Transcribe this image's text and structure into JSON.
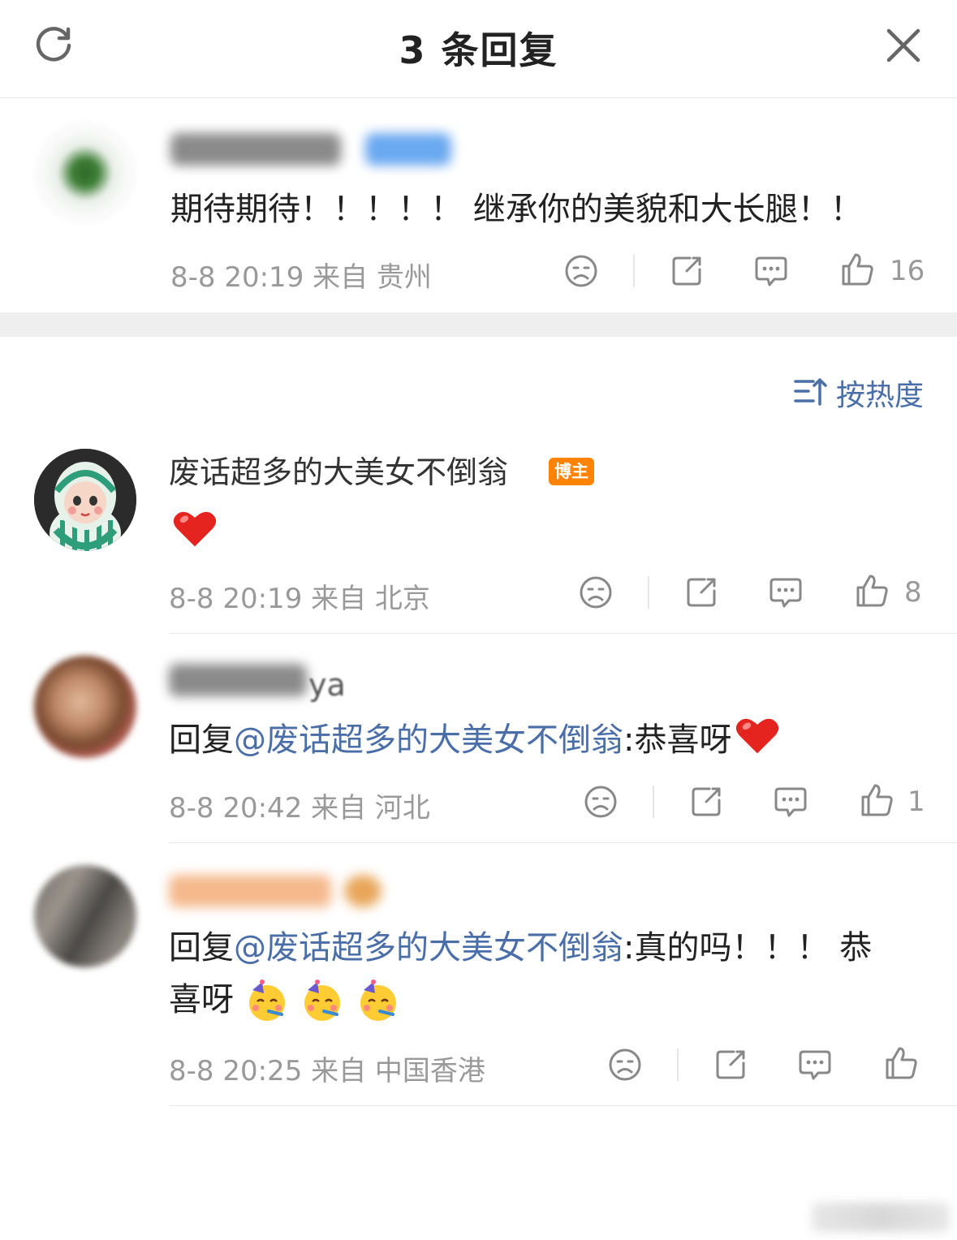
{
  "header": {
    "title": "3 条回复",
    "refresh_icon": "refresh-icon",
    "close_icon": "close-icon"
  },
  "root_comment": {
    "text": "期待期待！！！！！ 继承你的美貌和大长腿！！",
    "meta": "8-8 20:19 来自 贵州",
    "likes": "16"
  },
  "sort": {
    "label": "按热度",
    "icon": "sort-icon"
  },
  "replies": [
    {
      "author": "废话超多的大美女不倒翁",
      "badge": "博主",
      "meta": "8-8 20:19 来自 北京",
      "likes": "8"
    },
    {
      "author_suffix": "ya",
      "prefix": "回复",
      "mention": "@废话超多的大美女不倒翁",
      "text": ":恭喜呀",
      "meta": "8-8 20:42 来自 河北",
      "likes": "1"
    },
    {
      "prefix": "回复",
      "mention": "@废话超多的大美女不倒翁",
      "text": ":真的吗！！！ 恭",
      "text2": "喜呀",
      "meta": "8-8 20:25 来自 中国香港",
      "likes": ""
    }
  ],
  "colors": {
    "mention": "#4a6ea8",
    "badge": "#ff8200",
    "meta": "#999999"
  }
}
